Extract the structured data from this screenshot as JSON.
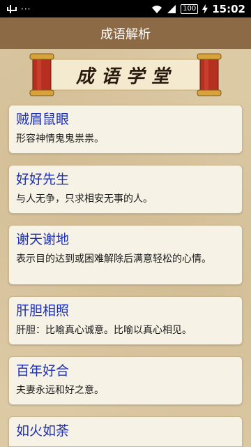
{
  "status_bar": {
    "dots": "···",
    "battery": "100",
    "time": "15:02"
  },
  "header": {
    "title": "成语解析"
  },
  "banner": {
    "text": "成语学堂"
  },
  "idioms": [
    {
      "title": "贼眉鼠眼",
      "desc": "形容神情鬼鬼祟祟。"
    },
    {
      "title": "好好先生",
      "desc": "与人无争，只求相安无事的人。"
    },
    {
      "title": "谢天谢地",
      "desc": "表示目的达到或困难解除后满意轻松的心情。"
    },
    {
      "title": "肝胆相照",
      "desc": "肝胆：比喻真心诚意。比喻以真心相见。"
    },
    {
      "title": "百年好合",
      "desc": "夫妻永远和好之意。"
    },
    {
      "title": "如火如荼",
      "desc": ""
    }
  ]
}
